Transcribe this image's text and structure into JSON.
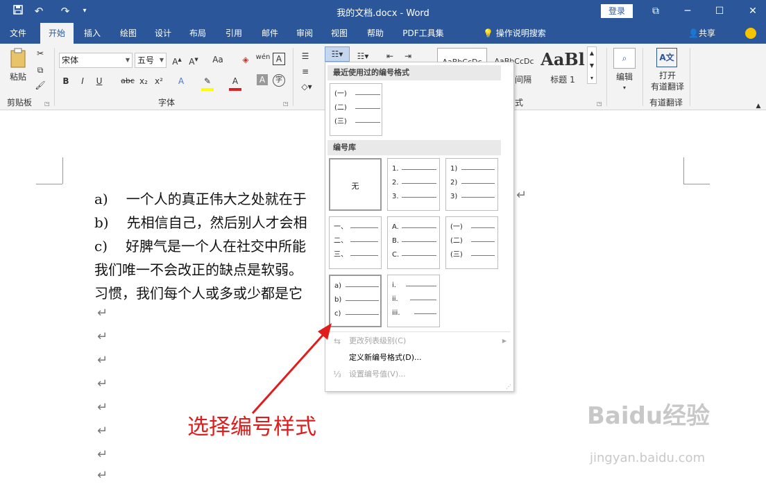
{
  "titlebar": {
    "doc_title": "我的文档.docx - Word",
    "login_label": "登录",
    "quick_access": [
      "save-icon",
      "undo-icon",
      "redo-icon",
      "customize-icon"
    ],
    "window_controls": [
      "ribbon-display-icon",
      "minimize-icon",
      "maximize-icon",
      "close-icon"
    ],
    "color": "#2b579a"
  },
  "tabs": [
    {
      "label": "文件"
    },
    {
      "label": "开始"
    },
    {
      "label": "插入"
    },
    {
      "label": "绘图"
    },
    {
      "label": "设计"
    },
    {
      "label": "布局"
    },
    {
      "label": "引用"
    },
    {
      "label": "邮件"
    },
    {
      "label": "审阅"
    },
    {
      "label": "视图"
    },
    {
      "label": "帮助"
    },
    {
      "label": "PDF工具集"
    }
  ],
  "active_tab": "开始",
  "tellme": "操作说明搜索",
  "share": "共享",
  "ribbon": {
    "clipboard": {
      "paste": "粘贴",
      "label": "剪贴板"
    },
    "font": {
      "name": "宋体",
      "size": "五号",
      "label": "字体",
      "case": "Aa",
      "bold": "B",
      "italic": "I",
      "underline": "U",
      "strike": "abc",
      "sub": "x₂",
      "sup": "x²",
      "phonetic": "wén",
      "border": "A"
    },
    "styles": {
      "preview1": "AaBbCcDc",
      "preview2": "AaBbCcDc",
      "preview3": "AaBl",
      "label2": "间隔",
      "label3": "标题 1",
      "group": "式"
    },
    "edit": {
      "label": "编辑"
    },
    "translate": {
      "line1": "打开",
      "line2": "有道翻译",
      "group": "有道翻译"
    }
  },
  "dropdown": {
    "recent_header": "最近使用过的编号格式",
    "library_header": "编号库",
    "recent_tile": [
      "(一)",
      "(二)",
      "(三)"
    ],
    "none_label": "无",
    "tiles": [
      [
        "1.",
        "2.",
        "3."
      ],
      [
        "1)",
        "2)",
        "3)"
      ],
      [
        "一、",
        "二、",
        "三、"
      ],
      [
        "A.",
        "B.",
        "C."
      ],
      [
        "(一)",
        "(二)",
        "(三)"
      ],
      [
        "a)",
        "b)",
        "c)"
      ],
      [
        "i.",
        "ii.",
        "iii."
      ]
    ],
    "menu": [
      {
        "label": "更改列表级别(C)",
        "disabled": true
      },
      {
        "label": "定义新编号格式(D)...",
        "disabled": false
      },
      {
        "label": "设置编号值(V)...",
        "disabled": true
      }
    ]
  },
  "document": {
    "lines": [
      {
        "prefix": "a)",
        "text": "一个人的真正伟大之处就在于"
      },
      {
        "prefix": "b)",
        "text": "先相信自己，然后别人才会相"
      },
      {
        "prefix": "c)",
        "text": "好脾气是一个人在社交中所能"
      },
      {
        "prefix": "",
        "text": "我们唯一不会改正的缺点是软弱。"
      },
      {
        "prefix": "",
        "text": "习惯，我们每个人或多或少都是它"
      }
    ],
    "para_mark": "↵"
  },
  "annotation": "选择编号样式",
  "watermark": "Baidu经验",
  "watermark_sub": "jingyan.baidu.com"
}
